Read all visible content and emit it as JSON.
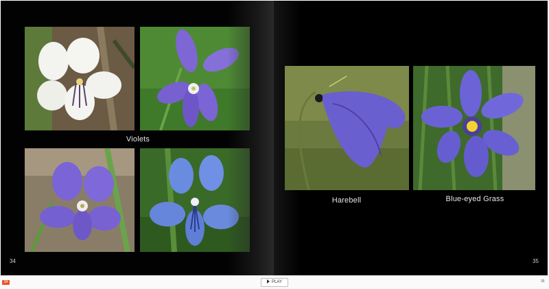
{
  "book": {
    "left_page": {
      "caption": "Violets",
      "page_number": "34"
    },
    "right_page": {
      "captions": [
        "Harebell",
        "Blue-eyed Grass"
      ],
      "page_number": "35"
    }
  },
  "toolbar": {
    "current_page_badge": "34",
    "play_label": "PLAY",
    "right_label": "35"
  },
  "colors": {
    "page_background": "#000000",
    "badge": "#e8552a",
    "violet": "#7d62d6",
    "white_violet": "#f4f4f2"
  }
}
